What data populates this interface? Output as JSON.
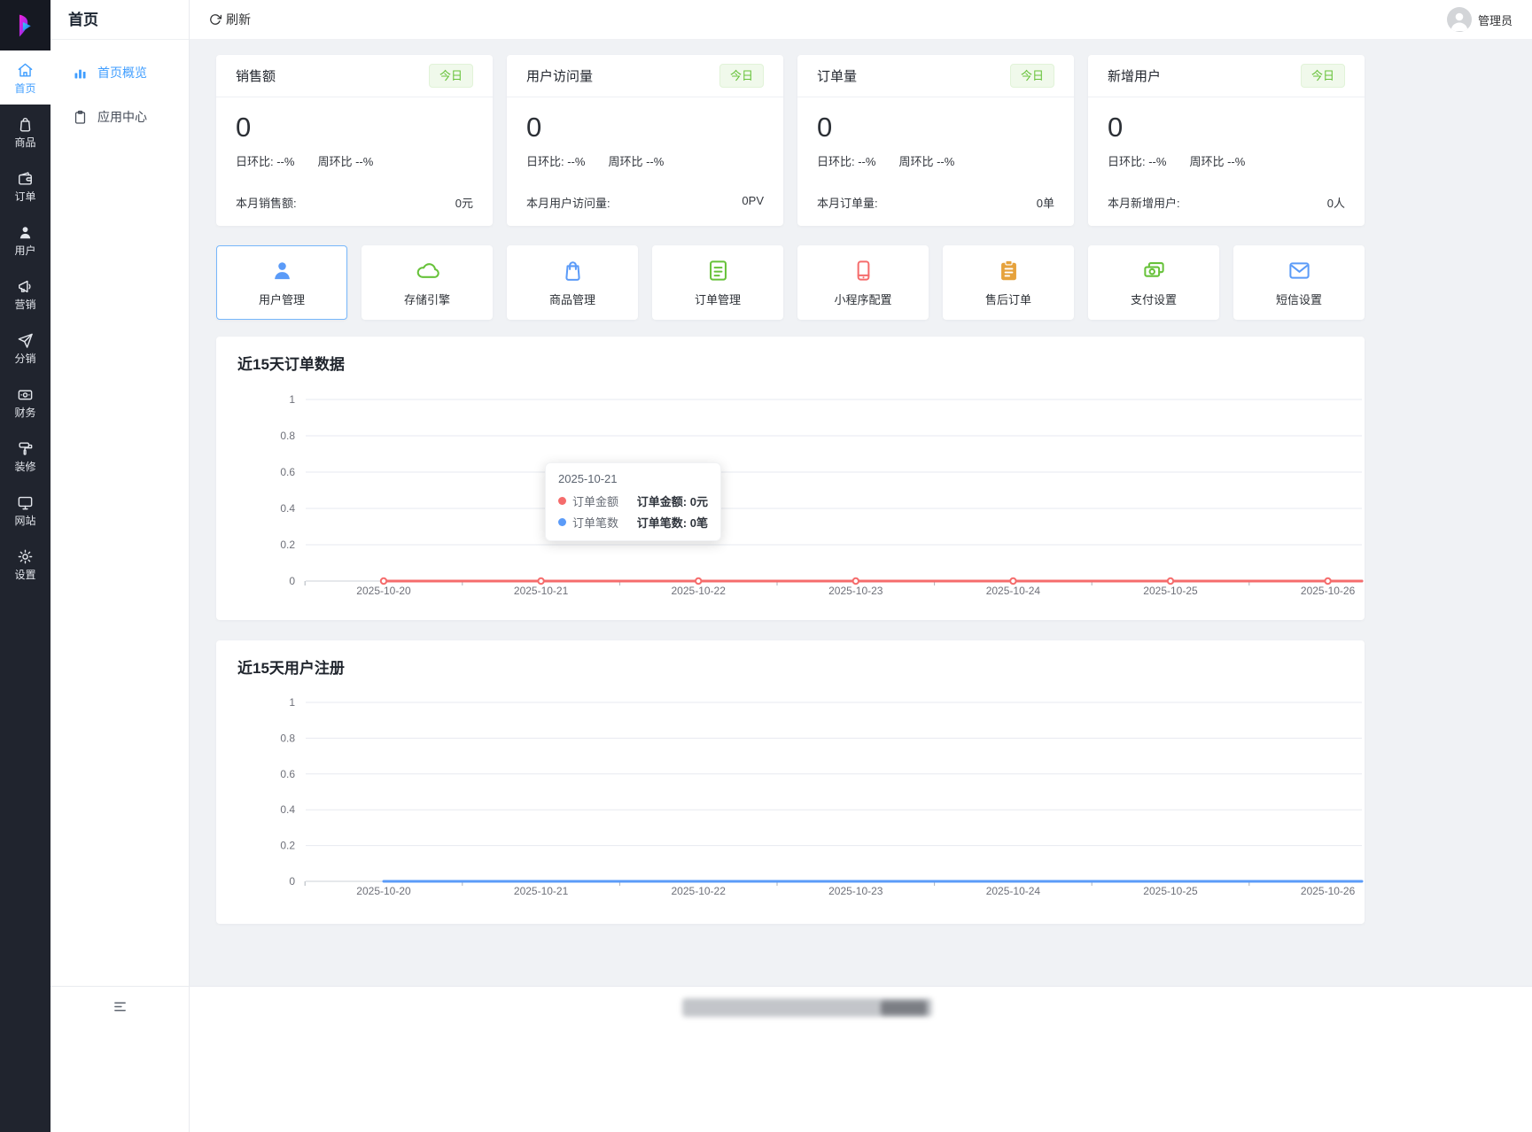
{
  "rail": {
    "items": [
      {
        "label": "首页",
        "icon": "home",
        "active": true
      },
      {
        "label": "商品",
        "icon": "goods"
      },
      {
        "label": "订单",
        "icon": "orders"
      },
      {
        "label": "用户",
        "icon": "users"
      },
      {
        "label": "营销",
        "icon": "marketing"
      },
      {
        "label": "分销",
        "icon": "distribution"
      },
      {
        "label": "财务",
        "icon": "finance"
      },
      {
        "label": "装修",
        "icon": "decorate"
      },
      {
        "label": "网站",
        "icon": "website"
      },
      {
        "label": "设置",
        "icon": "settings"
      }
    ]
  },
  "sidebar": {
    "title": "首页",
    "items": [
      {
        "label": "首页概览",
        "icon": "overview",
        "active": true
      },
      {
        "label": "应用中心",
        "icon": "appcenter"
      }
    ]
  },
  "topbar": {
    "refresh": "刷新",
    "username": "管理员"
  },
  "stats": [
    {
      "title": "销售额",
      "badge": "今日",
      "value": "0",
      "day": "日环比: --%",
      "week": "周环比 --%",
      "footer_label": "本月销售额:",
      "footer_value": "0元"
    },
    {
      "title": "用户访问量",
      "badge": "今日",
      "value": "0",
      "day": "日环比: --%",
      "week": "周环比 --%",
      "footer_label": "本月用户访问量:",
      "footer_value": "0PV"
    },
    {
      "title": "订单量",
      "badge": "今日",
      "value": "0",
      "day": "日环比: --%",
      "week": "周环比 --%",
      "footer_label": "本月订单量:",
      "footer_value": "0单"
    },
    {
      "title": "新增用户",
      "badge": "今日",
      "value": "0",
      "day": "日环比: --%",
      "week": "周环比 --%",
      "footer_label": "本月新增用户:",
      "footer_value": "0人"
    }
  ],
  "shortcuts": [
    {
      "label": "用户管理",
      "icon": "user-manage",
      "color": "#5b9bf8",
      "active": true
    },
    {
      "label": "存储引擎",
      "icon": "storage",
      "color": "#67c23a"
    },
    {
      "label": "商品管理",
      "icon": "goods-manage",
      "color": "#5b9bf8"
    },
    {
      "label": "订单管理",
      "icon": "order-manage",
      "color": "#67c23a"
    },
    {
      "label": "小程序配置",
      "icon": "miniapp",
      "color": "#f56c6c"
    },
    {
      "label": "售后订单",
      "icon": "aftersale",
      "color": "#e6a23c"
    },
    {
      "label": "支付设置",
      "icon": "payment",
      "color": "#67c23a"
    },
    {
      "label": "短信设置",
      "icon": "sms",
      "color": "#5b9bf8"
    }
  ],
  "chart_data": [
    {
      "type": "line",
      "title": "近15天订单数据",
      "x": [
        "2025-10-20",
        "2025-10-21",
        "2025-10-22",
        "2025-10-23",
        "2025-10-24",
        "2025-10-25",
        "2025-10-26"
      ],
      "series": [
        {
          "name": "订单笔数",
          "color": "#5b9bf8",
          "values": [
            0,
            0,
            0,
            0,
            0,
            0,
            0
          ],
          "markers": false
        },
        {
          "name": "订单金额",
          "color": "#f56c6c",
          "values": [
            0,
            0,
            0,
            0,
            0,
            0,
            0
          ],
          "markers": true
        }
      ],
      "yticks": [
        0,
        0.2,
        0.4,
        0.6,
        0.8,
        1
      ],
      "ylim": [
        0,
        1
      ],
      "grid": true,
      "legend": "none",
      "tooltip": {
        "date": "2025-10-21",
        "rows": [
          {
            "series": "订单金额",
            "dot": "#f56c6c",
            "value_label": "订单金额:",
            "value": "0元"
          },
          {
            "series": "订单笔数",
            "dot": "#5b9bf8",
            "value_label": "订单笔数:",
            "value": "0笔"
          }
        ]
      }
    },
    {
      "type": "line",
      "title": "近15天用户注册",
      "x": [
        "2025-10-20",
        "2025-10-21",
        "2025-10-22",
        "2025-10-23",
        "2025-10-24",
        "2025-10-25",
        "2025-10-26"
      ],
      "series": [
        {
          "name": "用户注册",
          "color": "#5b9bf8",
          "values": [
            0,
            0,
            0,
            0,
            0,
            0,
            0
          ],
          "markers": false
        }
      ],
      "yticks": [
        0,
        0.2,
        0.4,
        0.6,
        0.8,
        1
      ],
      "ylim": [
        0,
        1
      ],
      "grid": true,
      "legend": "none"
    }
  ]
}
